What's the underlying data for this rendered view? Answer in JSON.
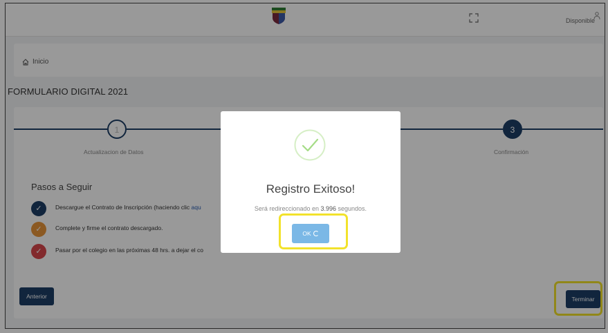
{
  "header": {
    "logo": "school-crest-icon",
    "status": "Disponible",
    "fullscreen_icon": "fullscreen-icon",
    "user_icon": "user-icon"
  },
  "breadcrumb": {
    "home_icon": "home-icon",
    "label": "Inicio"
  },
  "page_title": "FORMULARIO DIGITAL 2021",
  "stepper": {
    "steps": [
      {
        "number": "1",
        "label": "Actualizacion de Datos"
      },
      {
        "number": "3",
        "label": "Confirmación"
      }
    ]
  },
  "instructions": {
    "title": "Pasos a Seguir",
    "items": [
      {
        "text": "Descargue el Contrato de Inscripción (haciendo clic ",
        "link": "aqu",
        "color": "#1d3f66"
      },
      {
        "text": "Complete y firme el contrato descargado.",
        "color": "#e8953a"
      },
      {
        "text": "Pasar por el colegio en las próximas 48 hrs. a dejar el co",
        "color": "#d9464b"
      }
    ]
  },
  "buttons": {
    "previous": "Anterior",
    "finish": "Terminar"
  },
  "modal": {
    "title": "Registro Exitoso!",
    "message_prefix": "Será redireccionado en ",
    "seconds": "3.996",
    "message_suffix": " segundos.",
    "ok_label": "OK"
  },
  "colors": {
    "primary": "#1d3f66",
    "success": "#a5dc86",
    "ok_button": "#7bb8e6",
    "highlight": "#f2e22b"
  }
}
